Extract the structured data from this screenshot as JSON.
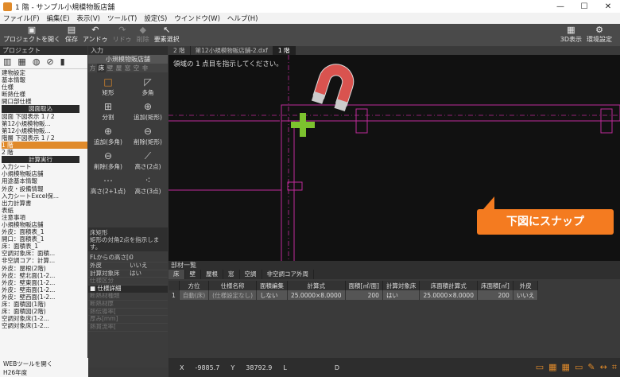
{
  "window": {
    "title": "1 階 - サンプル小規模物販店舗"
  },
  "menu": [
    "ファイル(F)",
    "編集(E)",
    "表示(V)",
    "ツール(T)",
    "設定(S)",
    "ウインドウ(W)",
    "ヘルプ(H)"
  ],
  "toolbar": {
    "open": "プロジェクトを開く",
    "save": "保存",
    "undo": "アンドゥ",
    "redo": "リドゥ",
    "delete": "削除",
    "select": "要素選択",
    "view3d": "3D表示",
    "env": "環境設定"
  },
  "project": {
    "header": "プロジェクト",
    "tree": [
      {
        "t": "建物設定",
        "k": "n"
      },
      {
        "t": "基本情報",
        "k": "n"
      },
      {
        "t": "仕様",
        "k": "n"
      },
      {
        "t": "  断熱仕様",
        "k": "n"
      },
      {
        "t": "  開口部仕様",
        "k": "n"
      },
      {
        "t": "図面取込",
        "k": "g"
      },
      {
        "t": "図面          下図表示 1 / 2",
        "k": "n"
      },
      {
        "t": "  第12小規模物販...",
        "k": "n"
      },
      {
        "t": "  第12小規模物販...",
        "k": "n"
      },
      {
        "t": "階層          下図表示 1 / 2",
        "k": "n"
      },
      {
        "t": "  1 階",
        "k": "s"
      },
      {
        "t": "  2 階",
        "k": "n"
      },
      {
        "t": "計算実行",
        "k": "g"
      },
      {
        "t": "入力シート",
        "k": "n"
      },
      {
        "t": "  小規模物販店舗",
        "k": "n"
      },
      {
        "t": "    用途基本情報",
        "k": "n"
      },
      {
        "t": "    外皮・設備情報",
        "k": "n"
      },
      {
        "t": "    入力シートExcel保...",
        "k": "n"
      },
      {
        "t": "出力計算書",
        "k": "n"
      },
      {
        "t": "  表紙",
        "k": "n"
      },
      {
        "t": "  注意事項",
        "k": "n"
      },
      {
        "t": "  小規模物販店舗",
        "k": "n"
      },
      {
        "t": "    外皮：面積表_1",
        "k": "n"
      },
      {
        "t": "    開口：面積表_1",
        "k": "n"
      },
      {
        "t": "    床：面積表_1",
        "k": "n"
      },
      {
        "t": "    空調対象床：面積...",
        "k": "n"
      },
      {
        "t": "    非空調コア：計算...",
        "k": "n"
      },
      {
        "t": "    外皮：屋根(2階)",
        "k": "n"
      },
      {
        "t": "    外皮：壁北面(1-2...",
        "k": "n"
      },
      {
        "t": "    外皮：壁東面(1-2...",
        "k": "n"
      },
      {
        "t": "    外皮：壁南面(1-2...",
        "k": "n"
      },
      {
        "t": "    外皮：壁西面(1-2...",
        "k": "n"
      },
      {
        "t": "    床：面積図(1階)",
        "k": "n"
      },
      {
        "t": "    床：面積図(2階)",
        "k": "n"
      },
      {
        "t": "    空調対象床(1-2...",
        "k": "n"
      },
      {
        "t": "    空調対象床(1-2...",
        "k": "n"
      }
    ],
    "web": "WEBツールを開く",
    "h26": "H26年度"
  },
  "input": {
    "header": "入力",
    "sub": "小規模物販店舗",
    "tabs": [
      "方",
      "床",
      "壁",
      "屋",
      "窓",
      "空",
      "非"
    ],
    "shapes": [
      "矩形",
      "多角",
      "分割",
      "追加(矩形)",
      "追加(多角)",
      "削除(矩形)",
      "削除(多角)",
      "高さ(2点)",
      "高さ(2+1点)",
      "高さ(3点)"
    ],
    "desc_title": "床矩形",
    "desc": "矩形の対角2点を指示します。",
    "props": [
      {
        "k": "FLからの高さ[m]",
        "v": "0"
      },
      {
        "k": "外皮",
        "v": "いいえ"
      },
      {
        "k": "計算対象床",
        "v": "はい"
      },
      {
        "k": "仕様区分",
        "v": ""
      }
    ],
    "section": "仕様詳細",
    "dimrows": [
      "断熱材種類",
      "断熱材厚",
      "熱伝導率[",
      "厚み[mm]",
      "熱貫流率["
    ]
  },
  "drawing": {
    "tabs": [
      "2 階",
      "第12小規模物販店舗-2.dxf",
      "1 階"
    ],
    "prompt": "領域の 1 点目を指示してください。",
    "callout": "下図にスナップ"
  },
  "parts": {
    "header": "部材一覧",
    "tabs": [
      "床",
      "壁",
      "屋根",
      "窓",
      "空調",
      "非空調コア外周"
    ],
    "columns": [
      "方位",
      "仕様名称",
      "面積編集",
      "計算式",
      "面積[㎡/面]",
      "計算対象床",
      "床面積計算式",
      "床面積[㎡]",
      "外皮"
    ],
    "rows": [
      {
        "no": "1",
        "dir": "自動(床)",
        "spec": "(仕様設定なし)",
        "edit": "しない",
        "formula": "25.0000×8.0000",
        "area": "200",
        "calc": "はい",
        "ffor": "25.0000×8.0000",
        "farea": "200",
        "env": "いいえ"
      }
    ]
  },
  "status": {
    "x_label": "X",
    "x": "-9885.7",
    "y_label": "Y",
    "y": "38792.9",
    "l": "L",
    "d": "D"
  },
  "colors": {
    "accent": "#e08a2a",
    "callout": "#f47b20",
    "magenta": "#c02a9a",
    "green": "#7cc22e"
  }
}
